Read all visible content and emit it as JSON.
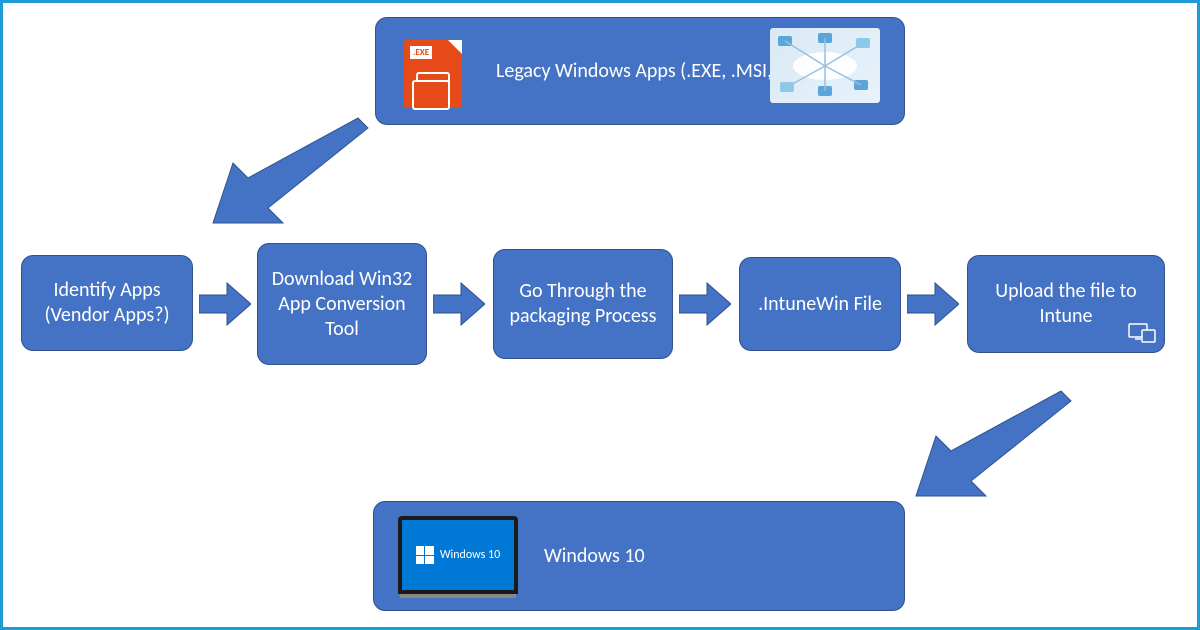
{
  "flow": {
    "top_box": {
      "label": "Legacy Windows Apps (.EXE, .MSI, etc.)",
      "icon_tag": ".EXE"
    },
    "steps": [
      {
        "label": "Identify Apps (Vendor Apps?)"
      },
      {
        "label": "Download Win32 App Conversion Tool"
      },
      {
        "label": "Go Through the packaging Process"
      },
      {
        "label": ".IntuneWin File"
      },
      {
        "label": "Upload the file to Intune"
      }
    ],
    "bottom_box": {
      "label": "Windows 10",
      "screen_text": "Windows 10"
    }
  }
}
